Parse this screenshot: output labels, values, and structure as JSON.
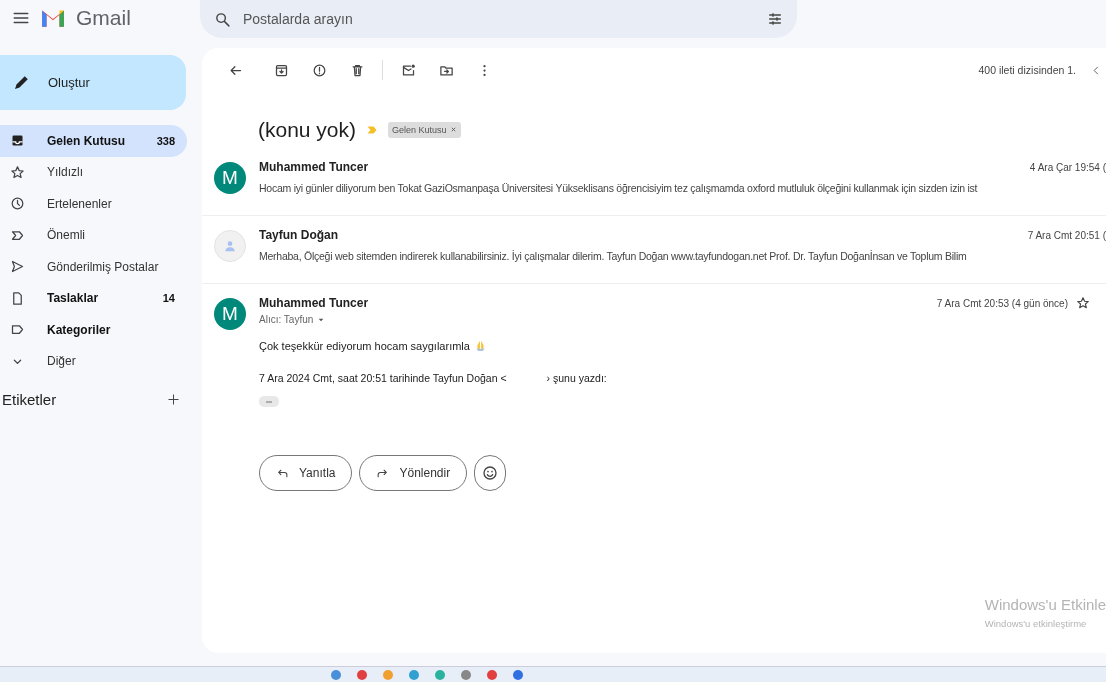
{
  "header": {
    "app_name": "Gmail",
    "search": {
      "placeholder": "Postalarda arayın"
    }
  },
  "compose": {
    "label": "Oluştur"
  },
  "sidebar": {
    "items": [
      {
        "kind": "inbox",
        "label": "Gelen Kutusu",
        "count": "338",
        "unread": true,
        "selected": true
      },
      {
        "kind": "star",
        "label": "Yıldızlı",
        "unread": false,
        "selected": false
      },
      {
        "kind": "snoozed",
        "label": "Ertelenenler",
        "unread": false,
        "selected": false
      },
      {
        "kind": "important",
        "label": "Önemli",
        "unread": false,
        "selected": false
      },
      {
        "kind": "sent",
        "label": "Gönderilmiş Postalar",
        "unread": false,
        "selected": false
      },
      {
        "kind": "drafts",
        "label": "Taslaklar",
        "count": "14",
        "unread": true,
        "selected": false
      },
      {
        "kind": "category",
        "label": "Kategoriler",
        "unread": true,
        "selected": false
      },
      {
        "kind": "more",
        "label": "Diğer",
        "unread": false,
        "selected": false
      }
    ],
    "labels_heading": "Etiketler"
  },
  "toolbar": {
    "position": "400 ileti dizisinden 1."
  },
  "thread": {
    "subject": "(konu yok)",
    "important": true,
    "labels": [
      {
        "label": "Gelen Kutusu"
      }
    ]
  },
  "messages": [
    {
      "kind": "collapsed",
      "avatar": {
        "kind": "letter",
        "letter": "M"
      },
      "sender": "Muhammed Tuncer",
      "date": "4 Ara Çar 19:54 (",
      "snippet": "Hocam iyi günler diliyorum ben Tokat GaziOsmanpaşa Üniversitesi Yükseklisans öğrencisiyim tez çalışmamda oxford mutluluk ölçeğini kullanmak için sizden izin ist"
    },
    {
      "kind": "collapsed",
      "avatar": {
        "kind": "person"
      },
      "sender": "Tayfun Doğan",
      "date": "7 Ara Cmt 20:51 (",
      "snippet": "Merhaba, Ölçeği web sitemden indirerek kullanabilirsiniz. İyi çalışmalar dilerim. Tayfun Doğan www.tayfundogan.net Prof. Dr. Tayfun Doğanİnsan ve Toplum Bilim"
    },
    {
      "kind": "expanded",
      "avatar": {
        "kind": "letter",
        "letter": "M"
      },
      "sender": "Muhammed Tuncer",
      "recipient": "Alıcı: Tayfun",
      "date": "7 Ara Cmt 20:53 (4 gün önce)",
      "starred": false,
      "body": "Çok teşekkür ediyorum hocam saygılarımla",
      "quote_intro": "7 Ara 2024 Cmt, saat 20:51 tarihinde Tayfun Doğan <",
      "quote_intro_end": "› şunu yazdı:"
    }
  ],
  "actions": [
    {
      "kind": "reply",
      "label": "Yanıtla"
    },
    {
      "kind": "forward",
      "label": "Yönlendir"
    },
    {
      "kind": "emoji"
    }
  ],
  "activation_notice": {
    "title": "Windows'u Etkinle",
    "subtitle": "Windows'u etkinleştirme"
  }
}
